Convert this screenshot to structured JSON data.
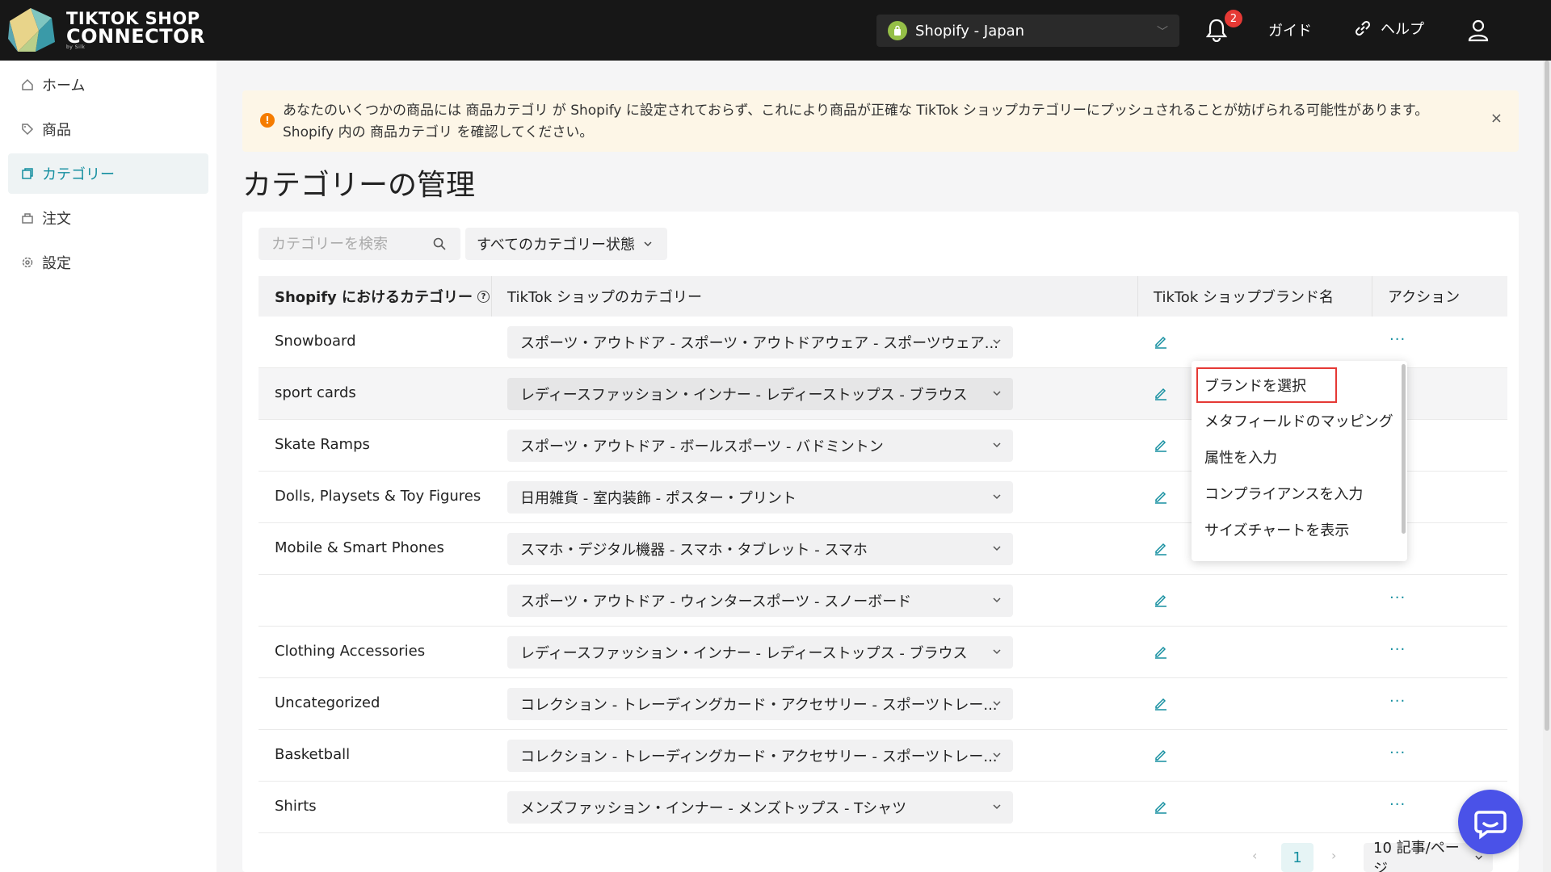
{
  "app": {
    "logo_line1": "TIKTOK SHOP",
    "logo_line2": "CONNECTOR",
    "logo_by": "by Silk"
  },
  "header": {
    "store_name": "Shopify - Japan",
    "notification_count": "2",
    "guide_label": "ガイド",
    "help_label": "ヘルプ"
  },
  "sidebar": {
    "items": [
      {
        "label": "ホーム",
        "icon": "home-icon"
      },
      {
        "label": "商品",
        "icon": "tag-icon"
      },
      {
        "label": "カテゴリー",
        "icon": "category-icon"
      },
      {
        "label": "注文",
        "icon": "order-icon"
      },
      {
        "label": "設定",
        "icon": "settings-icon"
      }
    ],
    "active": "カテゴリー"
  },
  "alert": {
    "line1": "あなたのいくつかの商品には 商品カテゴリ が Shopify に設定されておらず、これにより商品が正確な TikTok ショップカテゴリーにプッシュされることが妨げられる可能性があります。",
    "line2": "Shopify 内の 商品カテゴリ を確認してください。",
    "close": "×"
  },
  "page": {
    "title": "カテゴリーの管理"
  },
  "filters": {
    "search_placeholder": "カテゴリーを検索",
    "status_label": "すべてのカテゴリー状態"
  },
  "table": {
    "headers": {
      "shopify": "Shopify におけるカテゴリー",
      "tiktok": "TikTok ショップのカテゴリー",
      "brand": "TikTok ショップブランド名",
      "action": "アクション"
    },
    "rows": [
      {
        "shopify": "Snowboard",
        "tiktok": "スポーツ・アウトドア - スポーツ・アウトドアウェア - スポーツウェア..."
      },
      {
        "shopify": "sport cards",
        "tiktok": "レディースファッション・インナー - レディーストップス - ブラウス"
      },
      {
        "shopify": "Skate Ramps",
        "tiktok": "スポーツ・アウトドア - ボールスポーツ - バドミントン"
      },
      {
        "shopify": "Dolls, Playsets & Toy Figures",
        "tiktok": "日用雑貨 - 室内装飾 - ポスター・プリント"
      },
      {
        "shopify": "Mobile & Smart Phones",
        "tiktok": "スマホ・デジタル機器 - スマホ・タブレット - スマホ"
      },
      {
        "shopify": "",
        "tiktok": "スポーツ・アウトドア - ウィンタースポーツ - スノーボード"
      },
      {
        "shopify": "Clothing Accessories",
        "tiktok": "レディースファッション・インナー - レディーストップス - ブラウス"
      },
      {
        "shopify": "Uncategorized",
        "tiktok": "コレクション - トレーディングカード・アクセサリー - スポーツトレー..."
      },
      {
        "shopify": "Basketball",
        "tiktok": "コレクション - トレーディングカード・アクセサリー - スポーツトレー..."
      },
      {
        "shopify": "Shirts",
        "tiktok": "メンズファッション・インナー - メンズトップス - Tシャツ"
      }
    ],
    "more_label": "···"
  },
  "menu": {
    "items": [
      "ブランドを選択",
      "メタフィールドのマッピング",
      "属性を入力",
      "コンプライアンスを入力",
      "サイズチャートを表示"
    ]
  },
  "pagination": {
    "current_page": "1",
    "page_size": "10 記事/ページ"
  },
  "colors": {
    "accent": "#158fa0",
    "header_bg": "#171717",
    "alert_bg": "#fdf6e7",
    "highlight_border": "#e53935",
    "chat_fab": "#4a52e8"
  }
}
